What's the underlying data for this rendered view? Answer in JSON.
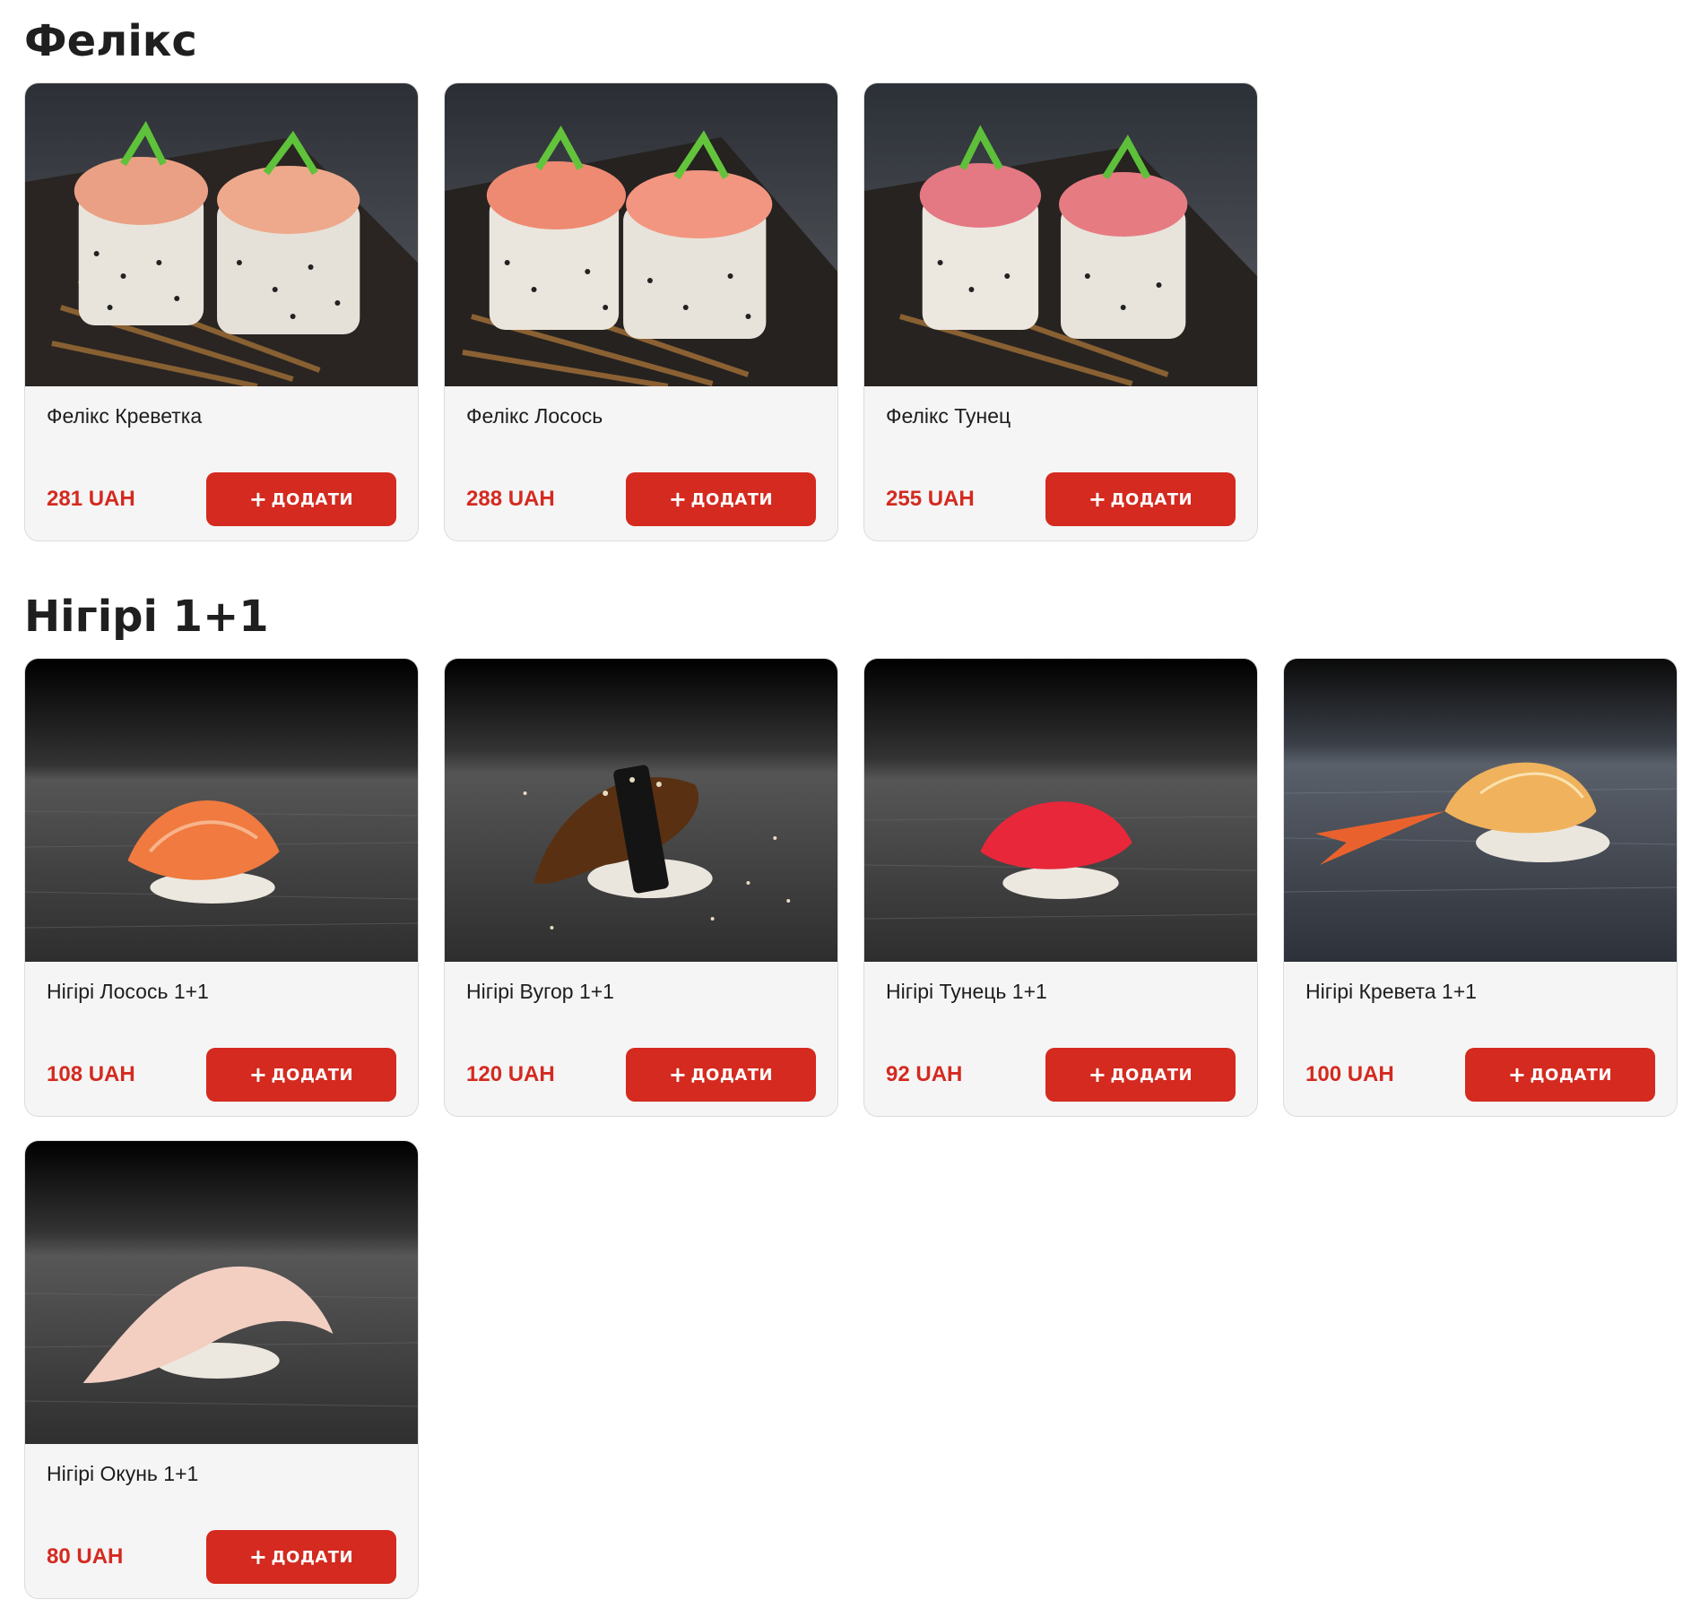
{
  "sections": [
    {
      "title": "Фелікс",
      "items": [
        {
          "name": "Фелікс Креветка",
          "price": "281 UAH",
          "image": "felix-shrimp-roll-photo"
        },
        {
          "name": "Фелікс Лосось",
          "price": "288 UAH",
          "image": "felix-salmon-roll-photo"
        },
        {
          "name": "Фелікс Тунец",
          "price": "255 UAH",
          "image": "felix-tuna-roll-photo"
        }
      ]
    },
    {
      "title": "Нігірі 1+1",
      "items": [
        {
          "name": "Нігірі Лосось 1+1",
          "price": "108 UAH",
          "image": "nigiri-salmon-photo"
        },
        {
          "name": "Нігірі Вугор 1+1",
          "price": "120 UAH",
          "image": "nigiri-eel-photo"
        },
        {
          "name": "Нігірі Тунець 1+1",
          "price": "92 UAH",
          "image": "nigiri-tuna-photo"
        },
        {
          "name": "Нігірі Кревета 1+1",
          "price": "100 UAH",
          "image": "nigiri-shrimp-photo"
        },
        {
          "name": "Нігірі Окунь 1+1",
          "price": "80 UAH",
          "image": "nigiri-perch-photo"
        }
      ]
    }
  ],
  "add_button": {
    "plus": "+",
    "label": "ДОДАТИ"
  },
  "colors": {
    "accent": "#d42a1f",
    "price": "#d42a20",
    "card_bg": "#f5f5f5"
  }
}
